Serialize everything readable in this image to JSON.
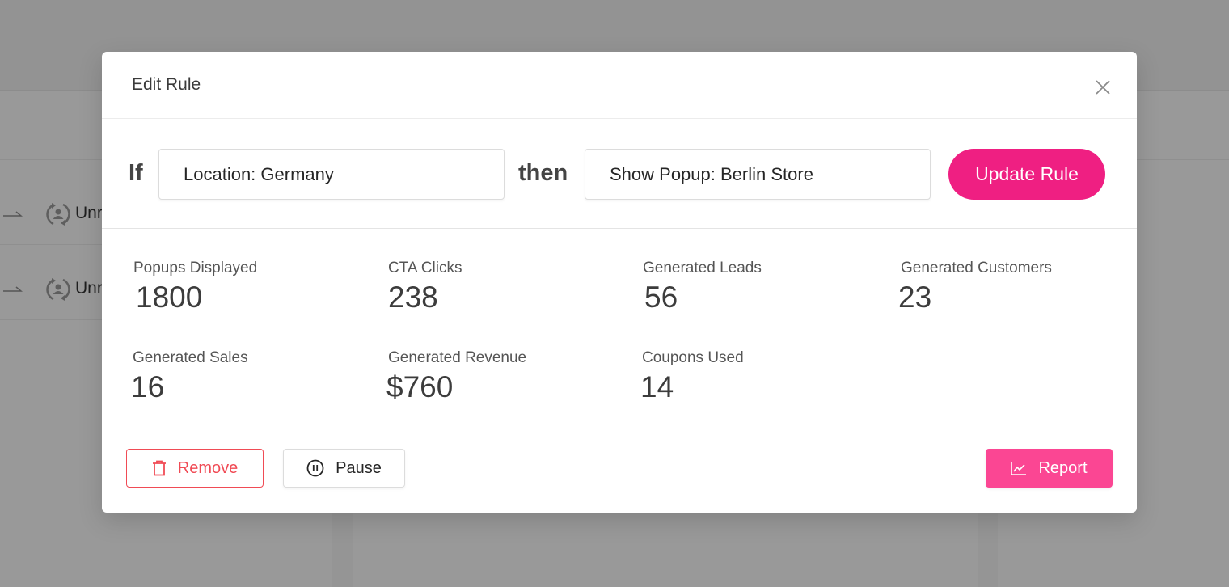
{
  "background": {
    "rows": [
      {
        "label": "Unr"
      },
      {
        "label": "Unr"
      }
    ]
  },
  "modal": {
    "title": "Edit Rule",
    "close_icon": "close-icon",
    "rule": {
      "if_label": "If",
      "condition_value": "Location: Germany",
      "then_label": "then",
      "action_value": "Show Popup: Berlin Store",
      "update_button": "Update Rule"
    },
    "stats": [
      {
        "label": "Popups Displayed",
        "value": "1800"
      },
      {
        "label": "CTA Clicks",
        "value": "238"
      },
      {
        "label": "Generated Leads",
        "value": "56"
      },
      {
        "label": "Generated Customers",
        "value": "23"
      },
      {
        "label": "Generated Sales",
        "value": "16"
      },
      {
        "label": "Generated Revenue",
        "value": "$760"
      },
      {
        "label": "Coupons Used",
        "value": "14"
      }
    ],
    "footer": {
      "remove_button": "Remove",
      "pause_button": "Pause",
      "report_button": "Report"
    }
  },
  "colors": {
    "accent": "#ef1f82",
    "report": "#fb4693",
    "danger": "#f04b55"
  }
}
